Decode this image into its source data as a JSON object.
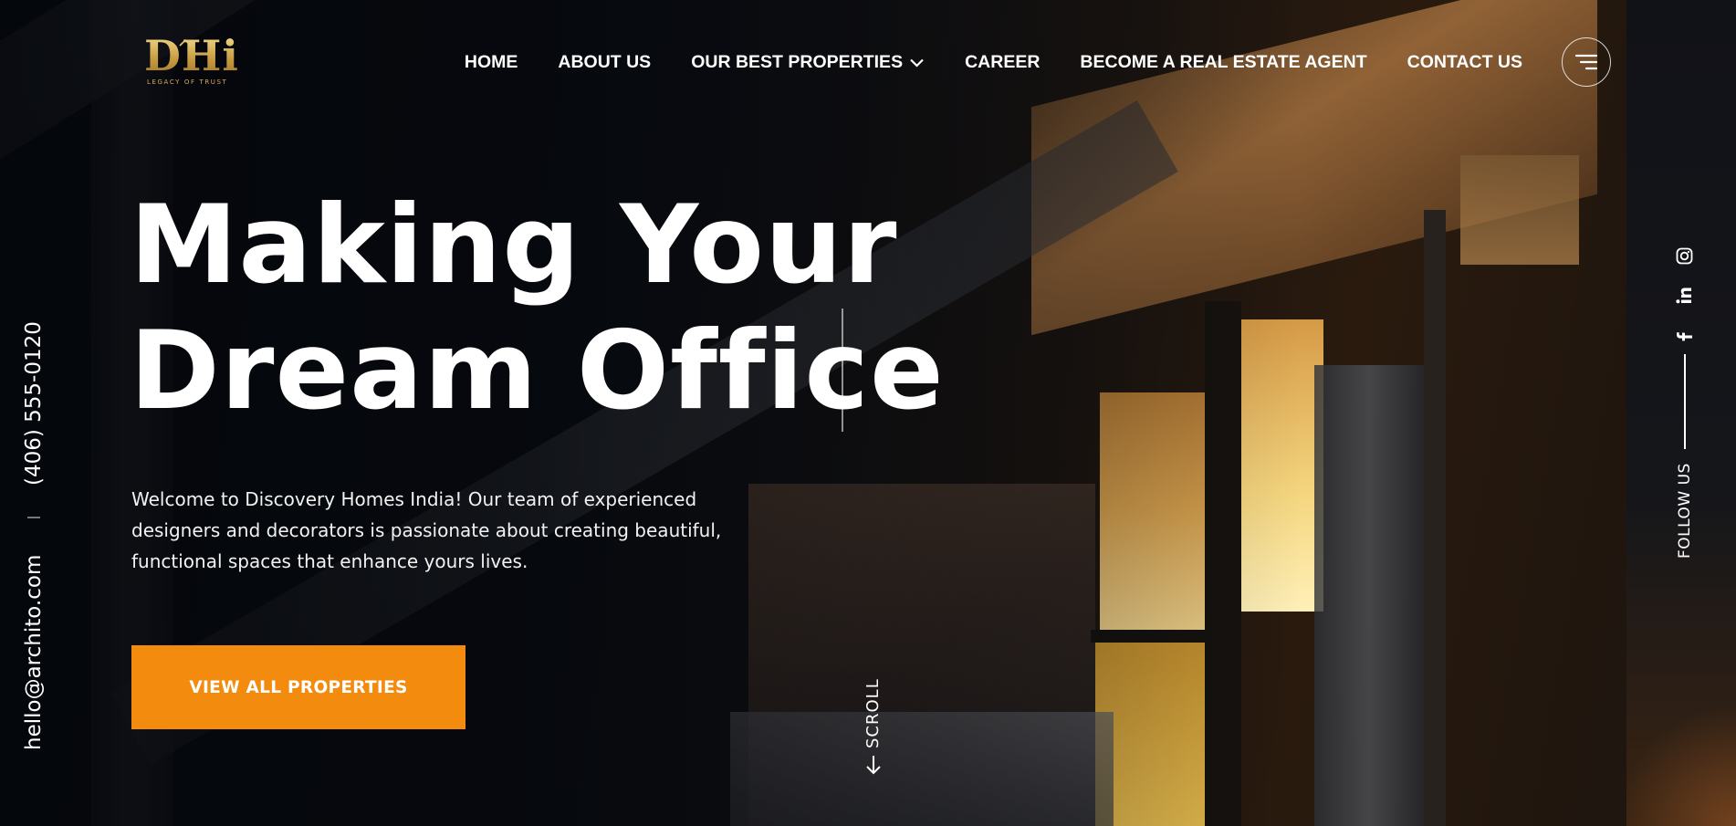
{
  "brand": {
    "logo_text": "DHi",
    "tagline": "LEGACY OF TRUST",
    "accent_color": "#f38b0e",
    "gold_color": "#d9b25a"
  },
  "nav": {
    "items": [
      {
        "label": "HOME"
      },
      {
        "label": "ABOUT US"
      },
      {
        "label": "OUR BEST PROPERTIES",
        "has_dropdown": true
      },
      {
        "label": "CAREER"
      },
      {
        "label": "BECOME A REAL ESTATE AGENT"
      },
      {
        "label": "CONTACT US"
      }
    ],
    "menu_icon": "hamburger-menu-icon"
  },
  "hero": {
    "title_line1": "Making Your",
    "title_line2": "Dream Office",
    "description": "Welcome to Discovery Homes India! Our team of experienced designers and decorators is passionate about creating beautiful, functional spaces that enhance yours lives.",
    "cta_label": "VIEW ALL PROPERTIES",
    "scroll_label": "SCROLL",
    "scroll_icon": "arrow-down-icon"
  },
  "contact": {
    "phone": "(406) 555-0120",
    "email": "hello@archito.com"
  },
  "social": {
    "label": "FOLLOW US",
    "icons": [
      "facebook-icon",
      "linkedin-icon",
      "instagram-icon"
    ]
  }
}
